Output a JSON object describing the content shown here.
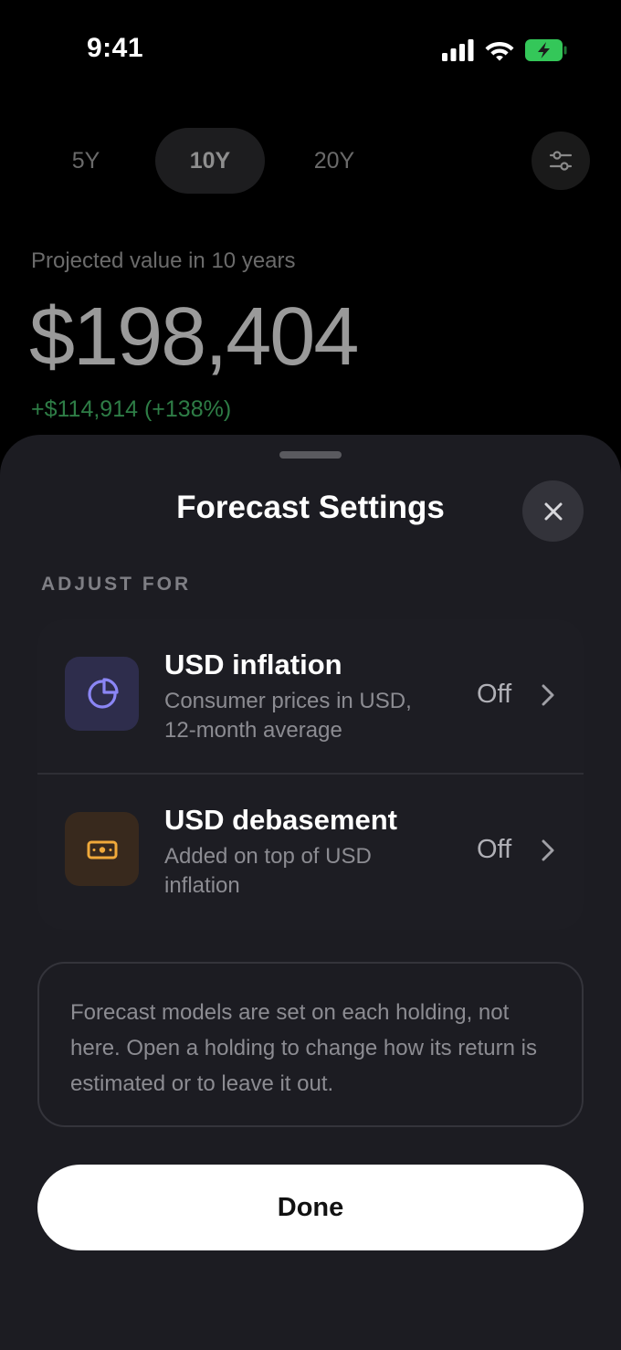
{
  "status_bar": {
    "time": "9:41",
    "icons": [
      "cellular-signal-icon",
      "wifi-icon",
      "battery-charging-icon"
    ],
    "battery_color": "#34c759"
  },
  "background": {
    "range_tabs": [
      {
        "label": "5Y",
        "active": false
      },
      {
        "label": "10Y",
        "active": true
      },
      {
        "label": "20Y",
        "active": false
      }
    ],
    "filter_icon": "sliders-icon",
    "projected_label": "Projected value in 10 years",
    "projected_value": "$198,404",
    "projected_change": "+$114,914 (+138%)",
    "change_color": "#2e7d46"
  },
  "sheet": {
    "title": "Forecast Settings",
    "close_icon": "close-icon",
    "section_label": "ADJUST FOR",
    "rows": [
      {
        "icon": "pie-chart-icon",
        "icon_color": "#8b86f5",
        "title": "USD inflation",
        "subtitle": "Consumer prices in USD, 12-month average",
        "value": "Off"
      },
      {
        "icon": "banknote-icon",
        "icon_color": "#f0a93a",
        "title": "USD debasement",
        "subtitle": "Added on top of USD inflation",
        "value": "Off"
      }
    ],
    "info_text": "Forecast models are set on each holding, not here. Open a holding to change how its return is estimated or to leave it out.",
    "done_label": "Done"
  }
}
